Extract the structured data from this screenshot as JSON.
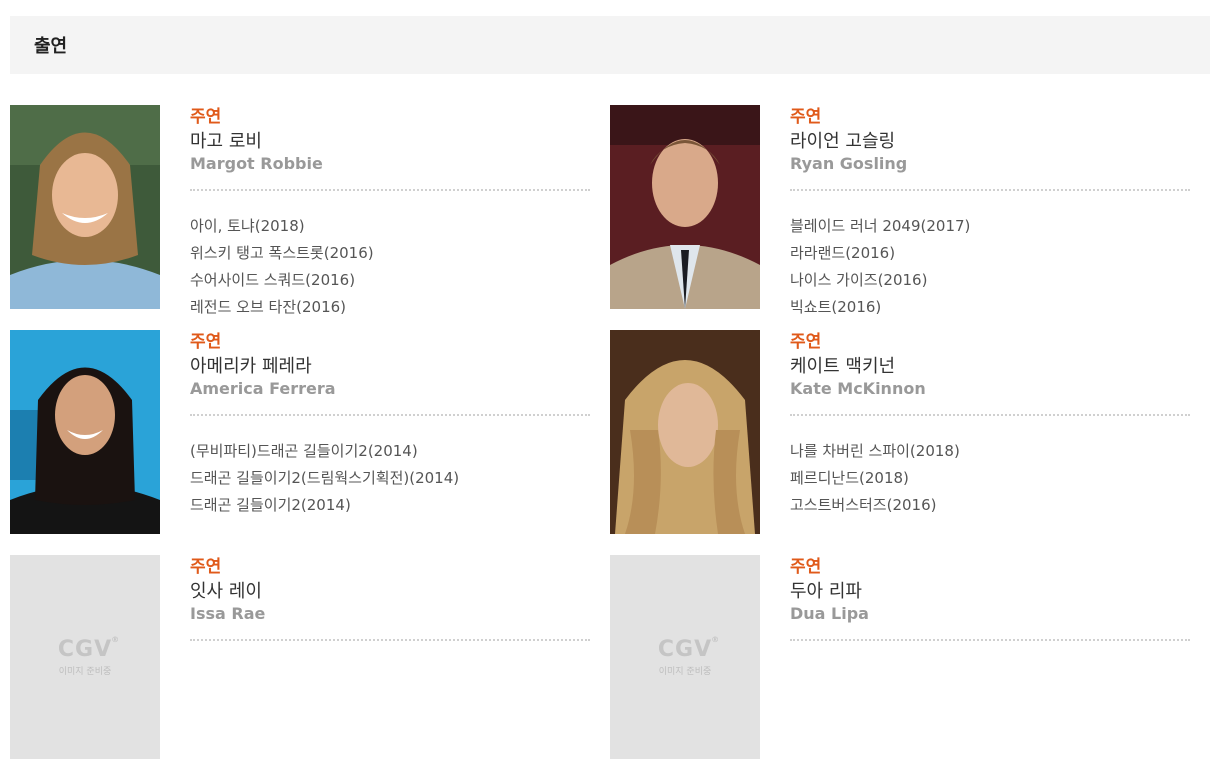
{
  "section": {
    "title": "출연"
  },
  "cast": [
    {
      "role": "주연",
      "name_ko": "마고 로비",
      "name_en": "Margot Robbie",
      "films": [
        "아이, 토냐(2018)",
        "위스키 탱고 폭스트롯(2016)",
        "수어사이드 스쿼드(2016)",
        "레전드 오브 타잔(2016)"
      ]
    },
    {
      "role": "주연",
      "name_ko": "라이언 고슬링",
      "name_en": "Ryan Gosling",
      "films": [
        "블레이드 러너 2049(2017)",
        "라라랜드(2016)",
        "나이스 가이즈(2016)",
        "빅쇼트(2016)"
      ]
    },
    {
      "role": "주연",
      "name_ko": "아메리카 페레라",
      "name_en": "America Ferrera",
      "films": [
        "(무비파티)드래곤 길들이기2(2014)",
        "드래곤 길들이기2(드림웍스기획전)(2014)",
        "드래곤 길들이기2(2014)"
      ]
    },
    {
      "role": "주연",
      "name_ko": "케이트 맥키넌",
      "name_en": "Kate McKinnon",
      "films": [
        "나를 차버린 스파이(2018)",
        "페르디난드(2018)",
        "고스트버스터즈(2016)"
      ]
    },
    {
      "role": "주연",
      "name_ko": "잇사 레이",
      "name_en": "Issa Rae",
      "films": []
    },
    {
      "role": "주연",
      "name_ko": "두아 리파",
      "name_en": "Dua Lipa",
      "films": []
    }
  ],
  "placeholder": {
    "logo": "CGV",
    "text": "이미지 준비중"
  }
}
